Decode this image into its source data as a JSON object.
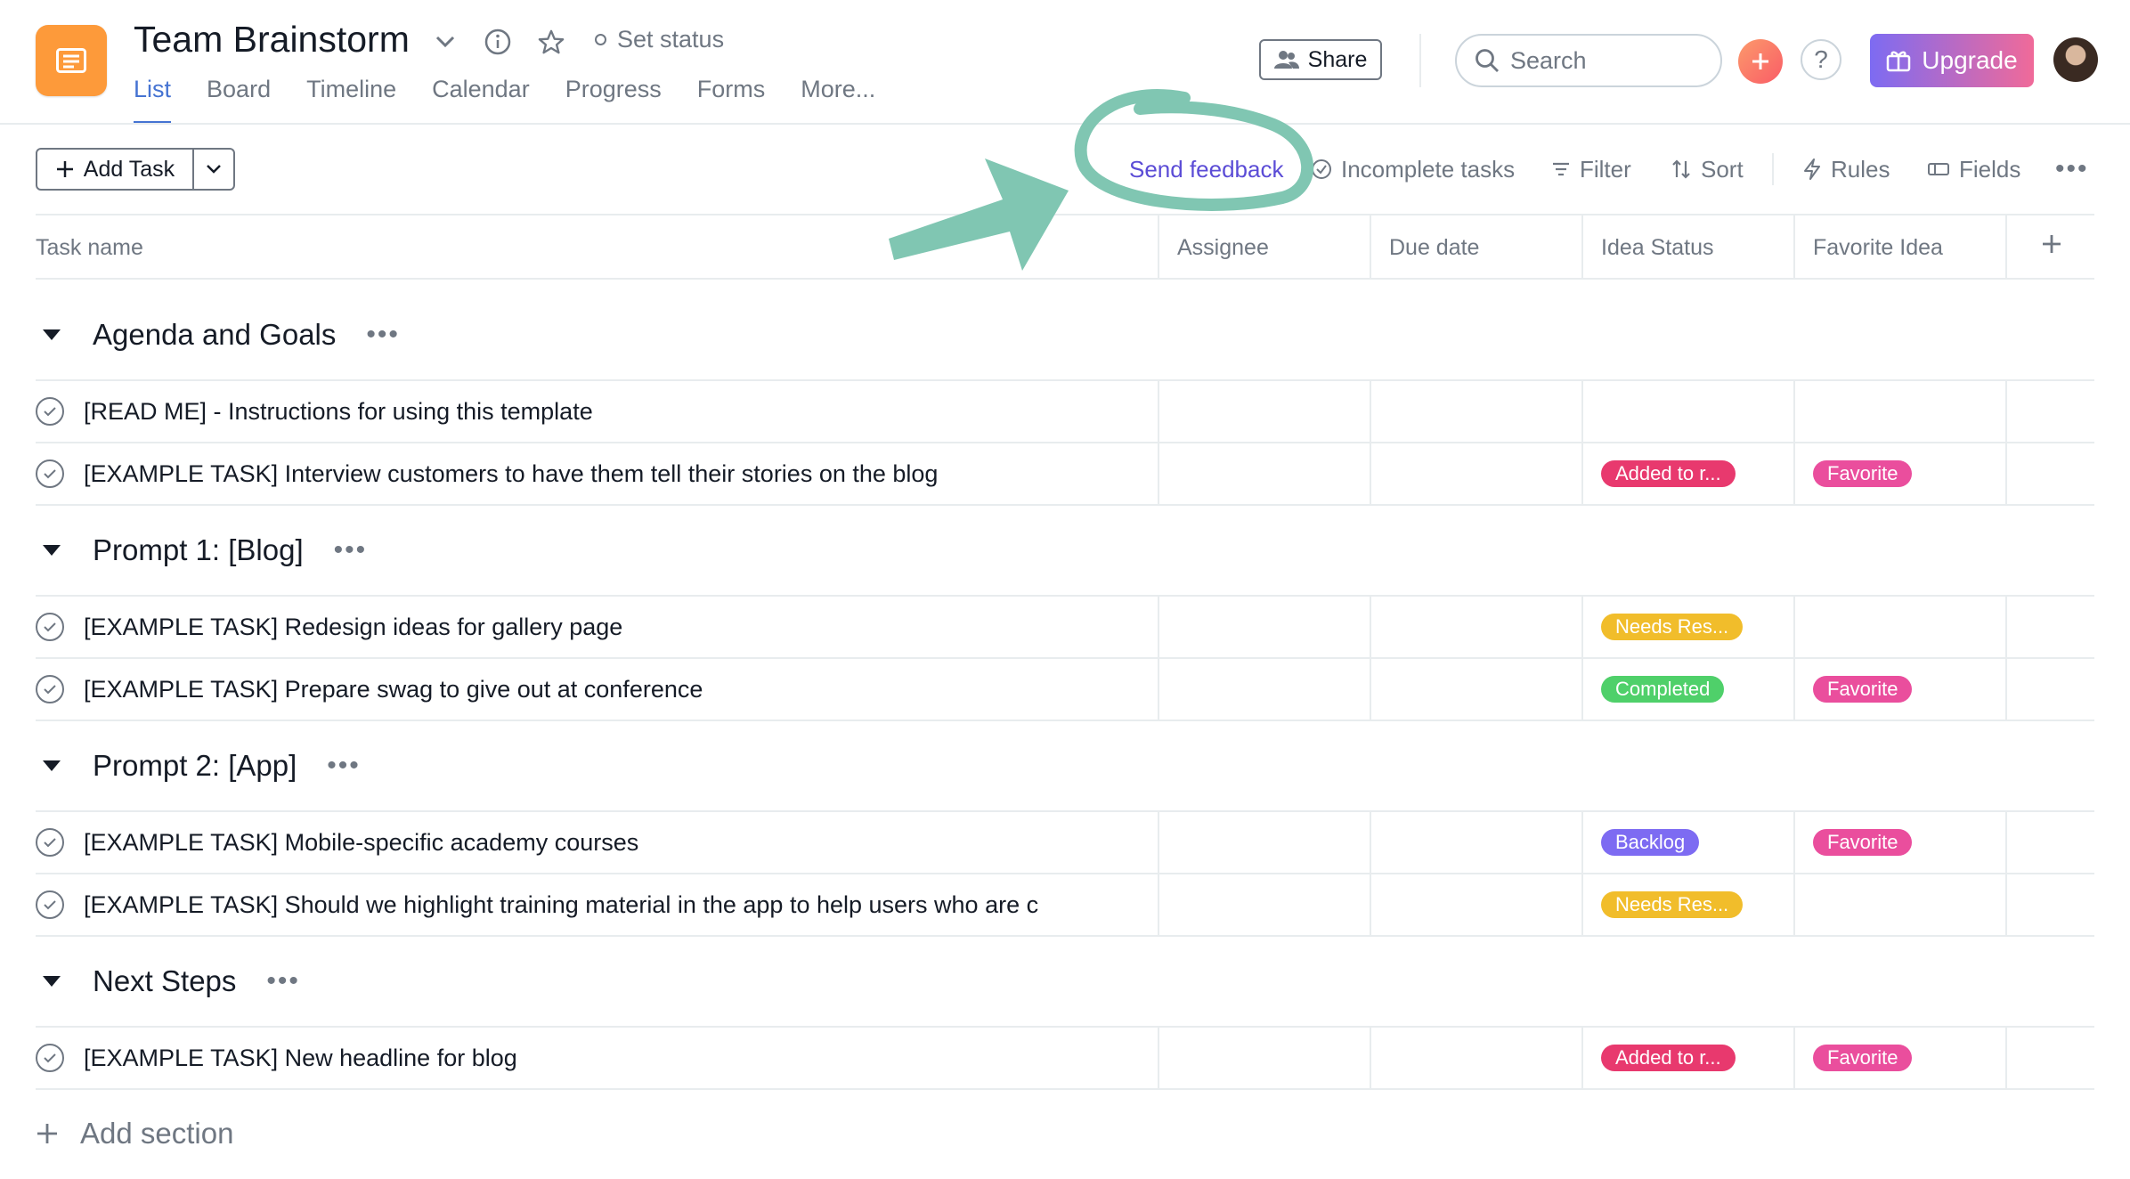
{
  "header": {
    "project_title": "Team Brainstorm",
    "set_status": "Set status",
    "tabs": [
      "List",
      "Board",
      "Timeline",
      "Calendar",
      "Progress",
      "Forms",
      "More..."
    ],
    "active_tab": "List",
    "share_label": "Share",
    "search_placeholder": "Search",
    "help_label": "?",
    "upgrade_label": "Upgrade"
  },
  "toolbar": {
    "add_task_label": "Add Task",
    "send_feedback": "Send feedback",
    "incomplete_tasks": "Incomplete tasks",
    "filter": "Filter",
    "sort": "Sort",
    "rules": "Rules",
    "fields": "Fields"
  },
  "table": {
    "columns": [
      "Task name",
      "Assignee",
      "Due date",
      "Idea Status",
      "Favorite Idea"
    ]
  },
  "sections": [
    {
      "title": "Agenda and Goals",
      "tasks": [
        {
          "name": "[READ ME] - Instructions for using this template",
          "status": "",
          "favorite": ""
        },
        {
          "name": "[EXAMPLE TASK] Interview customers to have them tell their stories on the blog",
          "status": "Added to r...",
          "favorite": "Favorite"
        }
      ]
    },
    {
      "title": "Prompt 1: [Blog]",
      "tasks": [
        {
          "name": "[EXAMPLE TASK] Redesign ideas for gallery page",
          "status": "Needs Res...",
          "favorite": ""
        },
        {
          "name": "[EXAMPLE TASK] Prepare swag to give out at conference",
          "status": "Completed",
          "favorite": "Favorite"
        }
      ]
    },
    {
      "title": "Prompt 2: [App]",
      "tasks": [
        {
          "name": "[EXAMPLE TASK] Mobile-specific academy courses",
          "status": "Backlog",
          "favorite": "Favorite"
        },
        {
          "name": "[EXAMPLE TASK] Should we highlight training material in the app to help users who are c",
          "status": "Needs Res...",
          "favorite": ""
        }
      ]
    },
    {
      "title": "Next Steps",
      "tasks": [
        {
          "name": "[EXAMPLE TASK] New headline for blog",
          "status": "Added to r...",
          "favorite": "Favorite"
        }
      ]
    }
  ],
  "add_section_label": "Add section",
  "colors": {
    "accent": "#4573d2",
    "status_added": "#e8396e",
    "status_needs": "#f1bd2b",
    "status_completed": "#4fd06a",
    "status_backlog": "#7d6bf2",
    "favorite": "#ea4e9d",
    "annotation": "#80c6b2"
  }
}
